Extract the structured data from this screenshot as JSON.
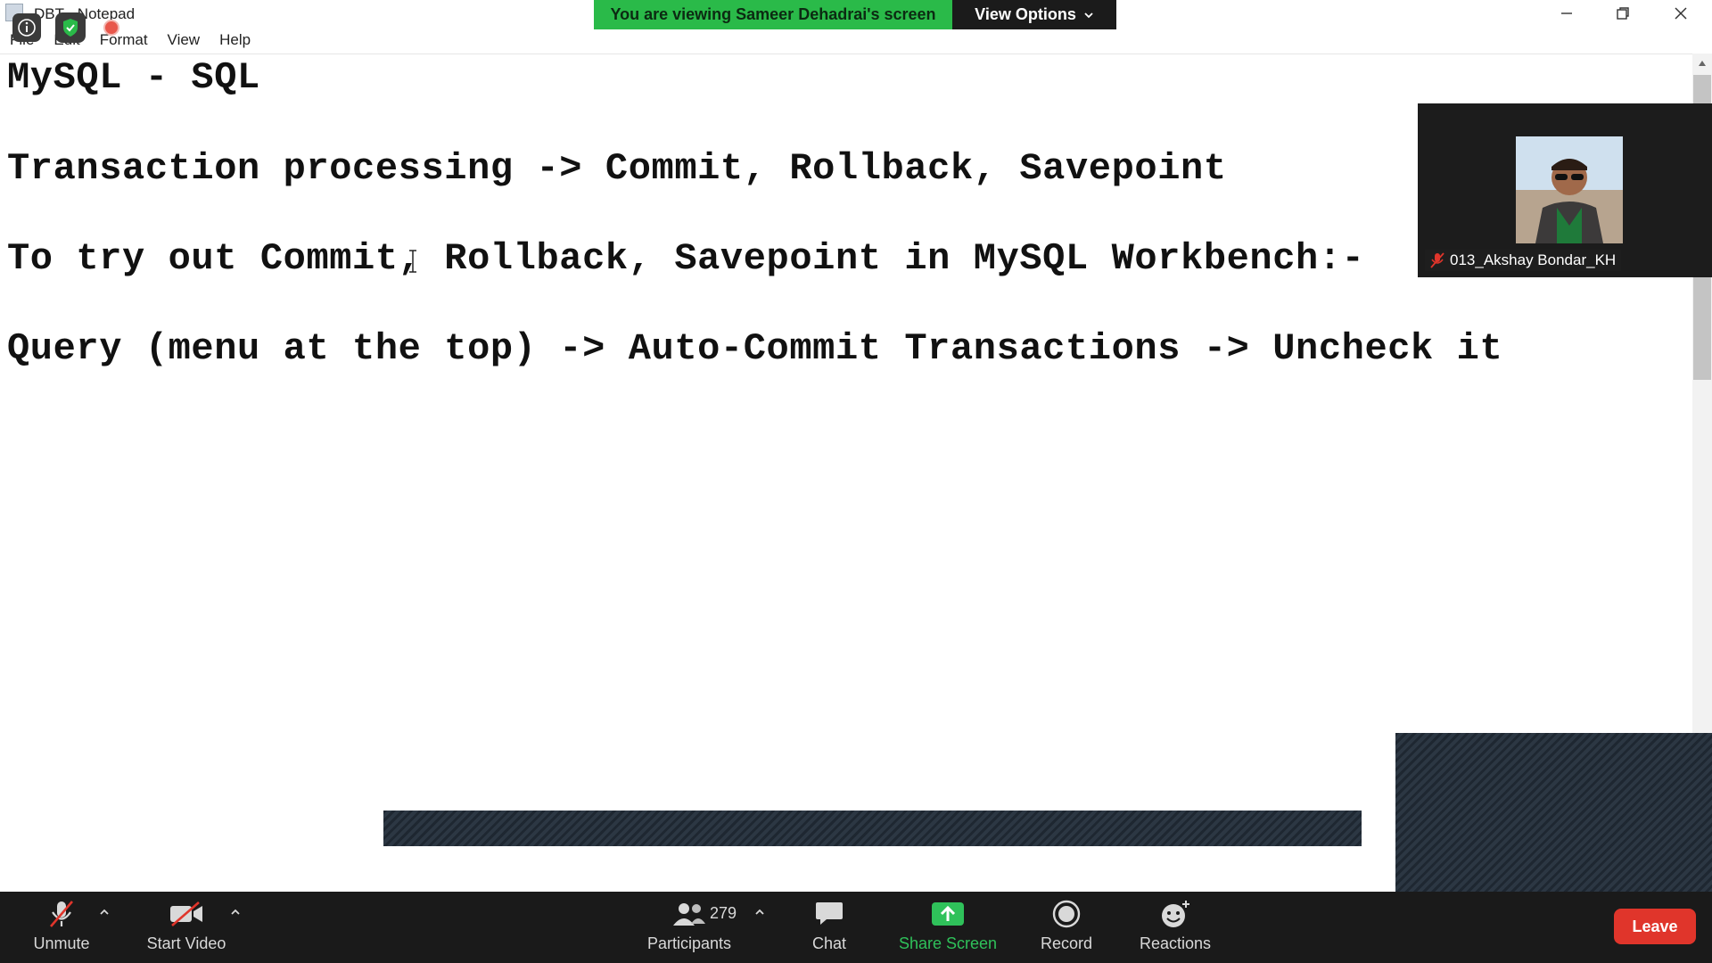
{
  "window": {
    "title": "DBT - Notepad",
    "menu": [
      "File",
      "Edit",
      "Format",
      "View",
      "Help"
    ]
  },
  "document": {
    "lines": [
      "MySQL - SQL",
      "Transaction processing -> Commit, Rollback, Savepoint",
      "To try out Commit, Rollback, Savepoint in MySQL Workbench:-",
      "Query (menu at the top) -> Auto-Commit Transactions -> Uncheck it"
    ]
  },
  "zoom": {
    "banner_text": "You are viewing Sameer Dehadrai's screen",
    "view_options_label": "View Options",
    "participant_tile": {
      "name": "013_Akshay Bondar_KH",
      "muted": true
    },
    "toolbar": {
      "unmute_label": "Unmute",
      "start_video_label": "Start Video",
      "participants_label": "Participants",
      "participant_count": "279",
      "chat_label": "Chat",
      "share_screen_label": "Share Screen",
      "record_label": "Record",
      "reactions_label": "Reactions",
      "leave_label": "Leave"
    }
  },
  "colors": {
    "banner_green": "#2aba49",
    "share_green": "#2fc15a",
    "leave_red": "#e0352b",
    "toolbar_bg": "#1a1a1a"
  }
}
